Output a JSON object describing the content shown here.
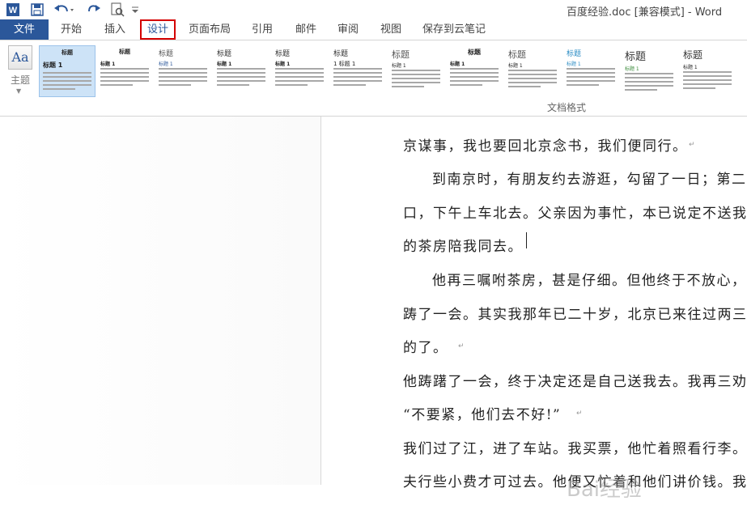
{
  "window": {
    "title": "百度经验.doc [兼容模式] - Word"
  },
  "quick_access": {
    "word_icon": "word-icon",
    "save_icon": "save-icon",
    "undo_icon": "undo-icon",
    "redo_icon": "redo-icon",
    "preview_icon": "print-preview-icon",
    "customize_icon": "customize-qat-icon"
  },
  "tabs": [
    "文件",
    "开始",
    "插入",
    "设计",
    "页面布局",
    "引用",
    "邮件",
    "审阅",
    "视图",
    "保存到云笔记"
  ],
  "ribbon": {
    "theme_label": "主题",
    "group_label": "文档格式",
    "styles": [
      {
        "title": "标题",
        "heading": "标题 1"
      },
      {
        "title": "标题",
        "heading": "标题 1"
      },
      {
        "title": "标题",
        "heading": "标题 1"
      },
      {
        "title": "标题",
        "heading": "标题 1"
      },
      {
        "title": "标题",
        "heading": "标题 1"
      },
      {
        "title": "标题",
        "heading": "1 标题 1"
      },
      {
        "title": "标题",
        "heading": "标题 1"
      },
      {
        "title": "标题",
        "heading": "标题 1"
      },
      {
        "title": "标题",
        "heading": "标题 1"
      },
      {
        "title": "标题",
        "heading": "标题 1"
      },
      {
        "title": "标题",
        "heading": "标题 1"
      },
      {
        "title": "标题",
        "heading": "标题 1"
      }
    ]
  },
  "document": {
    "lines": [
      "京谋事，我也要回北京念书，我们便同行。",
      "到南京时，有朋友约去游逛，勾留了一日；第二",
      "口，下午上车北去。父亲因为事忙，本已说定不送我",
      "的茶房陪我同去。",
      "他再三嘱咐茶房，甚是仔细。但他终于不放心，",
      "踌了一会。其实我那年已二十岁，北京已来往过两三",
      "的了。",
      "他踌躇了一会，终于决定还是自己送我去。我再三劝",
      "“不要紧，他们去不好!”",
      "我们过了江，进了车站。我买票，他忙着照看行李。",
      "夫行些小费才可过去。他便又忙着和他们讲价钱。我"
    ]
  },
  "watermark": "Bai经验"
}
